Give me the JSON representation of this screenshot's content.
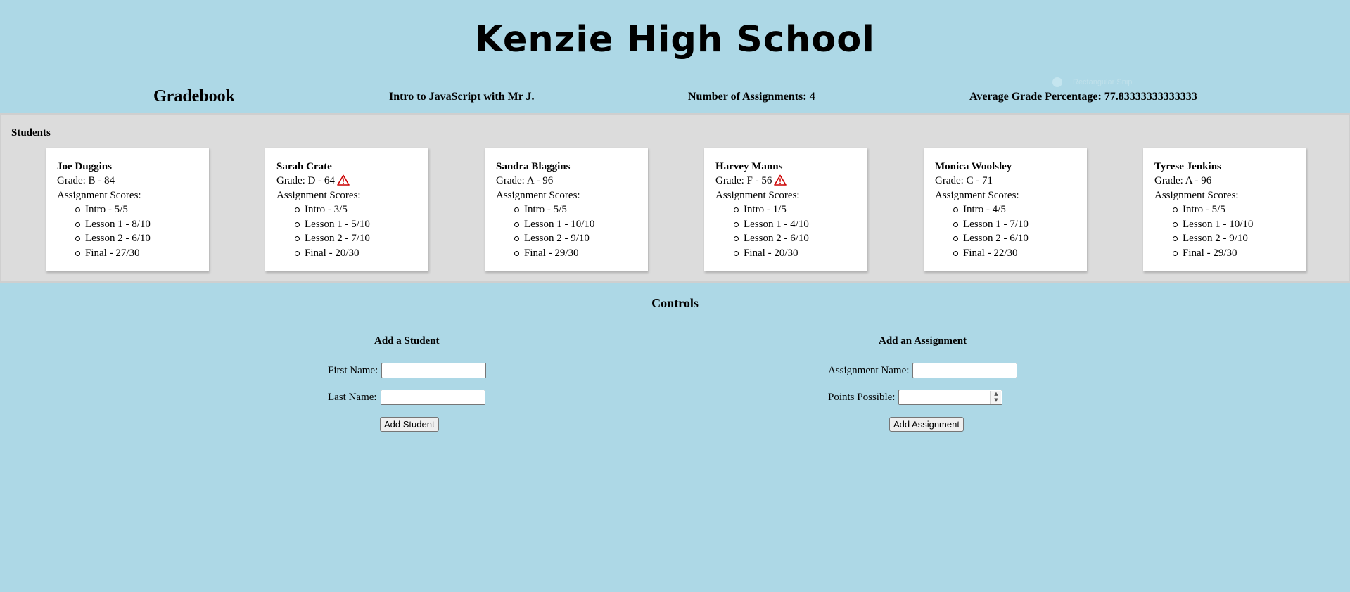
{
  "school": {
    "title": "Kenzie High School"
  },
  "header": {
    "gradebook_title": "Gradebook",
    "course": "Intro to JavaScript with Mr J.",
    "assignment_count": "Number of Assignments: 4",
    "average_grade": "Average Grade Percentage: 77.83333333333333",
    "faint_overlay_label": "Rectangular Snip"
  },
  "students": {
    "label": "Students",
    "scores_label": "Assignment Scores:",
    "warning_color": "#cc0000",
    "cards": [
      {
        "name": "Joe Duggins",
        "grade": "Grade: B - 84",
        "warning": false,
        "scores": [
          "Intro - 5/5",
          "Lesson 1 - 8/10",
          "Lesson 2 - 6/10",
          "Final - 27/30"
        ]
      },
      {
        "name": "Sarah Crate",
        "grade": "Grade: D - 64",
        "warning": true,
        "scores": [
          "Intro - 3/5",
          "Lesson 1 - 5/10",
          "Lesson 2 - 7/10",
          "Final - 20/30"
        ]
      },
      {
        "name": "Sandra Blaggins",
        "grade": "Grade: A - 96",
        "warning": false,
        "scores": [
          "Intro - 5/5",
          "Lesson 1 - 10/10",
          "Lesson 2 - 9/10",
          "Final - 29/30"
        ]
      },
      {
        "name": "Harvey Manns",
        "grade": "Grade: F - 56",
        "warning": true,
        "scores": [
          "Intro - 1/5",
          "Lesson 1 - 4/10",
          "Lesson 2 - 6/10",
          "Final - 20/30"
        ]
      },
      {
        "name": "Monica Woolsley",
        "grade": "Grade: C - 71",
        "warning": false,
        "scores": [
          "Intro - 4/5",
          "Lesson 1 - 7/10",
          "Lesson 2 - 6/10",
          "Final - 22/30"
        ]
      },
      {
        "name": "Tyrese Jenkins",
        "grade": "Grade: A - 96",
        "warning": false,
        "scores": [
          "Intro - 5/5",
          "Lesson 1 - 10/10",
          "Lesson 2 - 9/10",
          "Final - 29/30"
        ]
      }
    ]
  },
  "controls": {
    "title": "Controls",
    "add_student": {
      "title": "Add a Student",
      "first_name_label": "First Name:",
      "first_name_value": "",
      "last_name_label": "Last Name:",
      "last_name_value": "",
      "button_label": "Add Student"
    },
    "add_assignment": {
      "title": "Add an Assignment",
      "name_label": "Assignment Name:",
      "name_value": "",
      "points_label": "Points Possible:",
      "points_value": "",
      "button_label": "Add Assignment"
    }
  },
  "colors": {
    "page_background": "#add8e6",
    "students_background": "#dcdcdc",
    "card_background": "#ffffff"
  }
}
